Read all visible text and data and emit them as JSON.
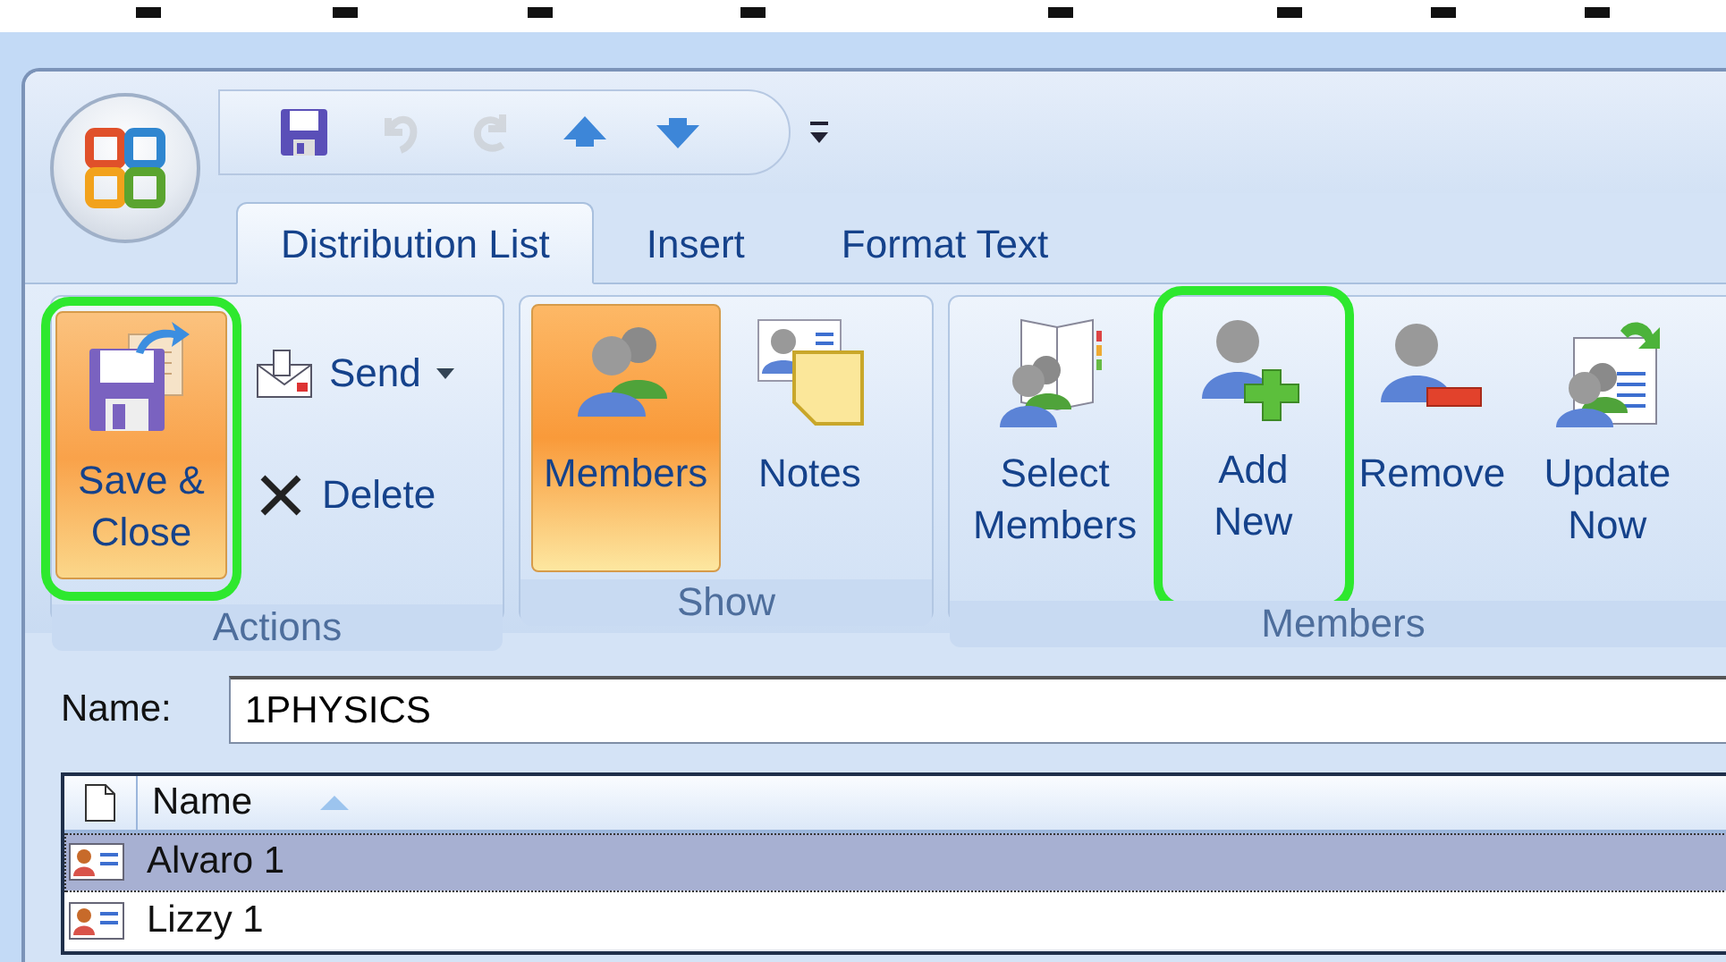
{
  "quick_access": [
    {
      "kind": "save",
      "disabled": false
    },
    {
      "kind": "undo",
      "disabled": true
    },
    {
      "kind": "redo",
      "disabled": true
    },
    {
      "kind": "previous",
      "disabled": false
    },
    {
      "kind": "next",
      "disabled": false
    }
  ],
  "tabs": [
    {
      "label": "Distribution List",
      "selected": true
    },
    {
      "label": "Insert",
      "selected": false
    },
    {
      "label": "Format Text",
      "selected": false
    }
  ],
  "ribbon": {
    "groups": [
      {
        "label": "Actions",
        "buttons": [
          {
            "kind": "large",
            "label": "Save &\nClose",
            "pressed": true,
            "highlighted": true
          },
          {
            "kind": "small",
            "label": "Send",
            "dropdown": true,
            "pressed": false,
            "highlighted": false
          },
          {
            "kind": "small",
            "label": "Delete",
            "dropdown": false,
            "pressed": false,
            "highlighted": false
          }
        ]
      },
      {
        "label": "Show",
        "buttons": [
          {
            "kind": "large",
            "label": "Members",
            "pressed": true,
            "highlighted": false
          },
          {
            "kind": "large",
            "label": "Notes",
            "pressed": false,
            "highlighted": false
          }
        ]
      },
      {
        "label": "Members",
        "buttons": [
          {
            "kind": "large",
            "label": "Select\nMembers",
            "pressed": false,
            "highlighted": false
          },
          {
            "kind": "large",
            "label": "Add\nNew",
            "pressed": false,
            "highlighted": true
          },
          {
            "kind": "large",
            "label": "Remove",
            "pressed": false,
            "highlighted": false
          },
          {
            "kind": "large",
            "label": "Update\nNow",
            "pressed": false,
            "highlighted": false
          }
        ]
      }
    ]
  },
  "form": {
    "name_label": "Name:",
    "name_value": "1PHYSICS"
  },
  "list": {
    "columns": [
      {
        "label": "Name",
        "sorted": true
      }
    ],
    "rows": [
      {
        "name": "Alvaro 1",
        "selected": true
      },
      {
        "name": "Lizzy 1",
        "selected": false
      }
    ]
  }
}
